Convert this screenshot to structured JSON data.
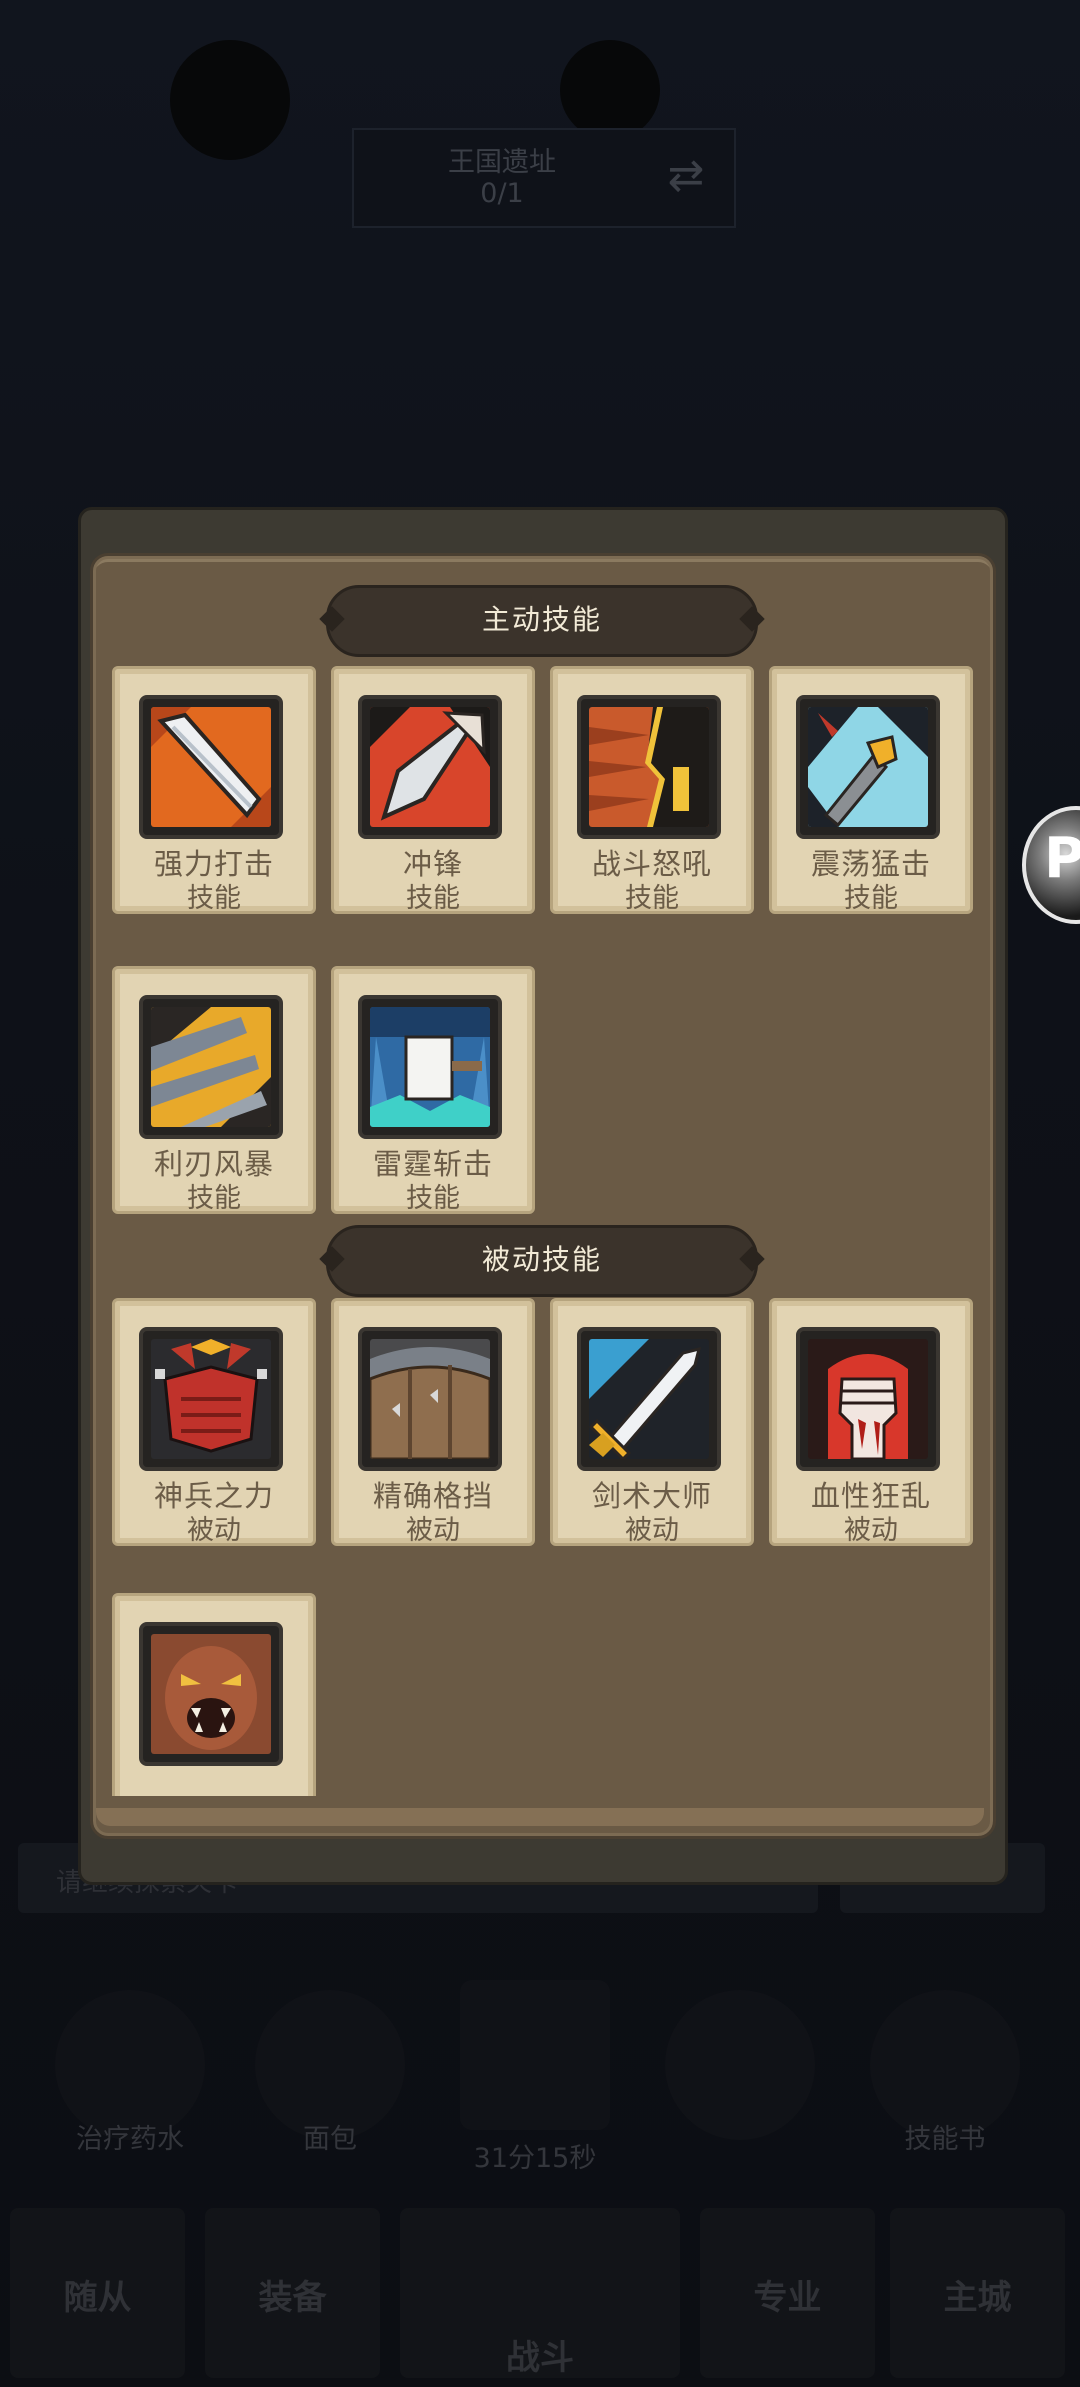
{
  "background": {
    "location_title": "王国遗址",
    "location_progress": "0/1",
    "message_bar": "请继续探索关卡",
    "items": [
      {
        "label": "治疗药水"
      },
      {
        "label": "面包"
      },
      {
        "label": "31分15秒"
      },
      {
        "label": ""
      },
      {
        "label": "技能书"
      }
    ],
    "tabs": [
      {
        "label": "随从"
      },
      {
        "label": "装备"
      },
      {
        "label": "战斗"
      },
      {
        "label": "专业"
      },
      {
        "label": "主城"
      }
    ]
  },
  "active_section": {
    "title": "主动技能",
    "skills": [
      {
        "name": "强力打击",
        "type": "技能",
        "icon": "sword-strike-icon"
      },
      {
        "name": "冲锋",
        "type": "技能",
        "icon": "charge-icon"
      },
      {
        "name": "战斗怒吼",
        "type": "技能",
        "icon": "battle-cry-icon"
      },
      {
        "name": "震荡猛击",
        "type": "技能",
        "icon": "shock-slam-icon"
      },
      {
        "name": "利刃风暴",
        "type": "技能",
        "icon": "blade-storm-icon"
      },
      {
        "name": "雷霆斩击",
        "type": "技能",
        "icon": "thunder-slash-icon"
      }
    ]
  },
  "passive_section": {
    "title": "被动技能",
    "skills": [
      {
        "name": "神兵之力",
        "type": "被动",
        "icon": "gauntlets-icon"
      },
      {
        "name": "精确格挡",
        "type": "被动",
        "icon": "shield-block-icon"
      },
      {
        "name": "剑术大师",
        "type": "被动",
        "icon": "sword-master-icon"
      },
      {
        "name": "血性狂乱",
        "type": "被动",
        "icon": "blood-fist-icon"
      },
      {
        "name": "",
        "type": "",
        "icon": "berserker-roar-icon"
      }
    ]
  },
  "colors": {
    "panel": "#6a5a45",
    "card": "#e2d4b3",
    "banner": "#3b332b",
    "card_text": "#6b5c47"
  }
}
